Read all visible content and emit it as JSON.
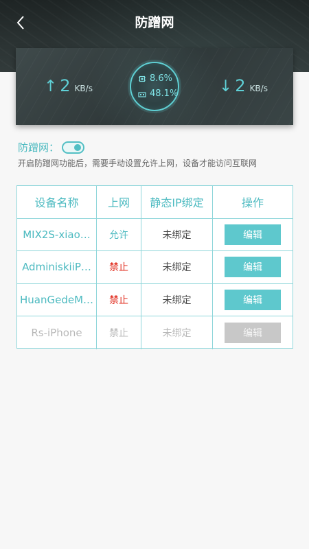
{
  "header": {
    "title": "防蹭网",
    "back_icon": "chevron-left-icon"
  },
  "stats": {
    "upload": {
      "arrow": "↑",
      "value": "2",
      "unit": "KB/s"
    },
    "download": {
      "arrow": "↓",
      "value": "2",
      "unit": "KB/s"
    },
    "cpu": "8.6%",
    "memory": "48.1%"
  },
  "toggle": {
    "label": "防蹭网：",
    "state": "on"
  },
  "description": "开启防蹭网功能后，需要手动设置允许上网，设备才能访问互联网",
  "table": {
    "headers": {
      "device": "设备名称",
      "internet": "上网",
      "static_ip": "静态IP绑定",
      "action": "操作"
    },
    "rows": [
      {
        "device": "MIX2S-xiao…",
        "internet": "允许",
        "binding": "未绑定",
        "action": "编辑"
      },
      {
        "device": "AdminiskiiP…",
        "internet": "禁止",
        "binding": "未绑定",
        "action": "编辑"
      },
      {
        "device": "HuanGedeM…",
        "internet": "禁止",
        "binding": "未绑定",
        "action": "编辑"
      },
      {
        "device": "Rs-iPhone",
        "internet": "禁止",
        "binding": "未绑定",
        "action": "编辑"
      }
    ]
  },
  "colors": {
    "accent": "#5ec8cd",
    "deny": "#e0281a",
    "disabled": "#c8c8c8"
  }
}
